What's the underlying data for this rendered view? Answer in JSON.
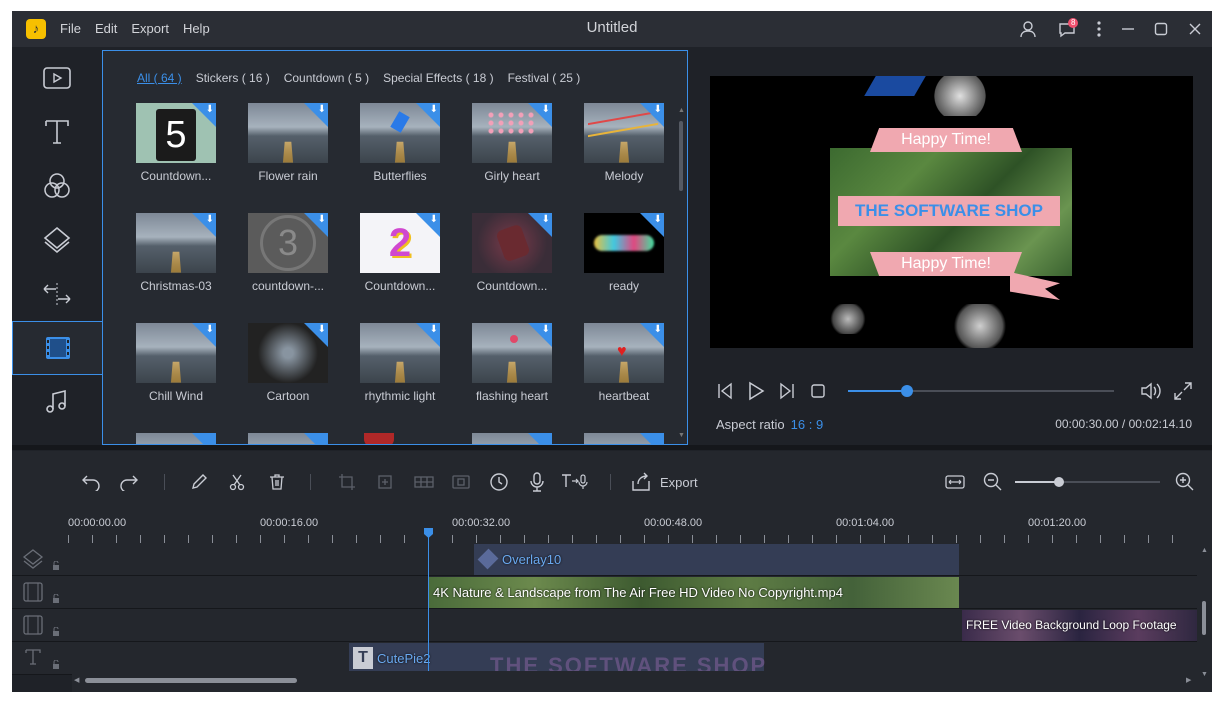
{
  "window": {
    "title": "Untitled",
    "notification_count": "8"
  },
  "menu": [
    "File",
    "Edit",
    "Export",
    "Help"
  ],
  "sidebar": {
    "items": [
      {
        "name": "media",
        "icon": "media-play-icon"
      },
      {
        "name": "text",
        "icon": "text-icon"
      },
      {
        "name": "filters",
        "icon": "filters-icon"
      },
      {
        "name": "overlays",
        "icon": "layers-icon"
      },
      {
        "name": "transitions",
        "icon": "transition-icon"
      },
      {
        "name": "elements",
        "icon": "film-icon",
        "active": true
      },
      {
        "name": "music",
        "icon": "music-icon"
      }
    ]
  },
  "library": {
    "categories": [
      "All ( 64 )",
      "Stickers ( 16 )",
      "Countdown ( 5 )",
      "Special Effects ( 18 )",
      "Festival ( 25 )"
    ],
    "active_category": 0,
    "items": [
      {
        "label": "Countdown...",
        "art": "countdown5"
      },
      {
        "label": "Flower rain",
        "art": "road"
      },
      {
        "label": "Butterflies",
        "art": "road"
      },
      {
        "label": "Girly heart",
        "art": "road"
      },
      {
        "label": "Melody",
        "art": "road"
      },
      {
        "label": "Christmas-03",
        "art": "road"
      },
      {
        "label": "countdown-...",
        "art": "countdown3"
      },
      {
        "label": "Countdown...",
        "art": "countdown2"
      },
      {
        "label": "Countdown...",
        "art": "countdown-red"
      },
      {
        "label": "ready",
        "art": "ready"
      },
      {
        "label": "Chill Wind",
        "art": "road"
      },
      {
        "label": "Cartoon",
        "art": "cartoon"
      },
      {
        "label": "rhythmic light",
        "art": "road"
      },
      {
        "label": "flashing heart",
        "art": "road"
      },
      {
        "label": "heartbeat",
        "art": "road"
      }
    ],
    "countdown_digits": {
      "five": "5",
      "three": "3",
      "two": "2"
    }
  },
  "preview": {
    "banner_top": "Happy Time!",
    "banner_middle": "THE SOFTWARE SHOP",
    "banner_bottom": "Happy Time!",
    "aspect_label": "Aspect ratio",
    "aspect_value": "16 : 9",
    "time": "00:00:30.00 / 00:02:14.10",
    "progress": 0.22
  },
  "toolbar": {
    "export_label": "Export",
    "zoom_level": 0.3
  },
  "timeline": {
    "ruler": [
      "00:00:00.00",
      "00:00:16.00",
      "00:00:32.00",
      "00:00:48.00",
      "00:01:04.00",
      "00:01:20.00"
    ],
    "tracks": [
      {
        "type": "overlay",
        "clip": "Overlay10"
      },
      {
        "type": "video",
        "clip": "4K Nature & Landscape from The Air Free HD Video No Copyright.mp4"
      },
      {
        "type": "video",
        "clip": "FREE Video Background Loop Footage"
      },
      {
        "type": "text",
        "clip": "CutePie2"
      }
    ],
    "watermark": "THE SOFTWARE SHOP"
  },
  "colors": {
    "accent": "#3b8fe8",
    "background": "#1f2228",
    "panel": "#262a31"
  }
}
